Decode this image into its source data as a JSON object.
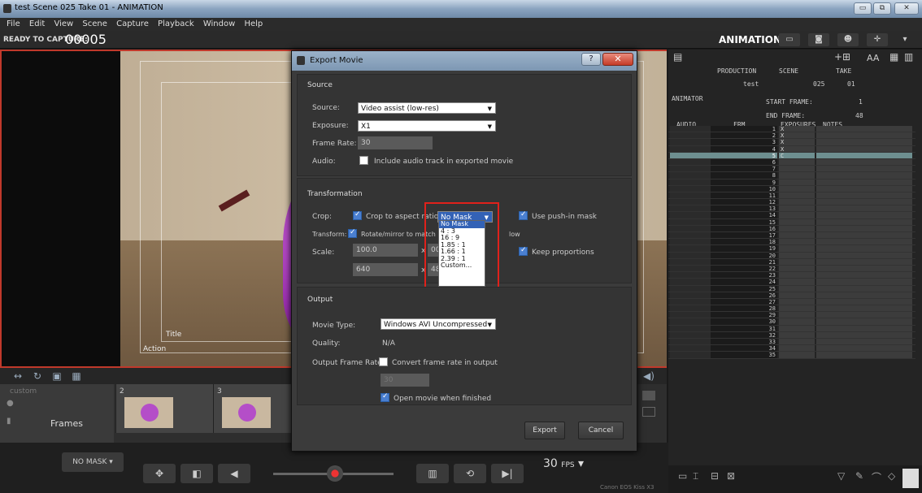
{
  "window": {
    "title": "test  Scene 025  Take 01 - ANIMATION",
    "minimize": "▭",
    "restore": "⧉",
    "close": "✕"
  },
  "menu": [
    "File",
    "Edit",
    "View",
    "Scene",
    "Capture",
    "Playback",
    "Window",
    "Help"
  ],
  "capture_bar": {
    "label": "READY TO CAPTURE:",
    "frame": "00005",
    "mode": "ANIMATION"
  },
  "viewer": {
    "title_guide": "Title",
    "action_guide": "Action"
  },
  "timeline": {
    "custom_label": "custom",
    "frames_label": "Frames",
    "thumbs": [
      {
        "n": "2"
      },
      {
        "n": "3"
      }
    ]
  },
  "bottom": {
    "mask_button": "NO MASK",
    "fps": "30",
    "fps_unit": "FPS",
    "camera": "Canon EOS Kiss X3"
  },
  "xsheet": {
    "hdr_production": "PRODUCTION",
    "hdr_scene": "SCENE",
    "hdr_take": "TAKE",
    "production": "test",
    "scene": "025",
    "take": "01",
    "animator_label": "ANIMATOR",
    "start_frame_label": "START FRAME:",
    "start_frame": "1",
    "end_frame_label": "END FRAME:",
    "end_frame": "48",
    "col_audio": "AUDIO",
    "col_frm": "FRM",
    "col_exposures": "EXPOSURES",
    "col_notes": "NOTES",
    "rows": [
      {
        "n": "1",
        "x": "X"
      },
      {
        "n": "2",
        "x": "X"
      },
      {
        "n": "3",
        "x": "X"
      },
      {
        "n": "4",
        "x": "X"
      },
      {
        "n": "5",
        "x": "C"
      },
      {
        "n": "6",
        "x": ""
      },
      {
        "n": "7",
        "x": ""
      },
      {
        "n": "8",
        "x": ""
      },
      {
        "n": "9",
        "x": ""
      },
      {
        "n": "10",
        "x": ""
      },
      {
        "n": "11",
        "x": ""
      },
      {
        "n": "12",
        "x": ""
      },
      {
        "n": "13",
        "x": ""
      },
      {
        "n": "14",
        "x": ""
      },
      {
        "n": "15",
        "x": ""
      },
      {
        "n": "16",
        "x": ""
      },
      {
        "n": "17",
        "x": ""
      },
      {
        "n": "18",
        "x": ""
      },
      {
        "n": "19",
        "x": ""
      },
      {
        "n": "20",
        "x": ""
      },
      {
        "n": "21",
        "x": ""
      },
      {
        "n": "22",
        "x": ""
      },
      {
        "n": "23",
        "x": ""
      },
      {
        "n": "24",
        "x": ""
      },
      {
        "n": "25",
        "x": ""
      },
      {
        "n": "26",
        "x": ""
      },
      {
        "n": "27",
        "x": ""
      },
      {
        "n": "28",
        "x": ""
      },
      {
        "n": "29",
        "x": ""
      },
      {
        "n": "30",
        "x": ""
      },
      {
        "n": "31",
        "x": ""
      },
      {
        "n": "32",
        "x": ""
      },
      {
        "n": "33",
        "x": ""
      },
      {
        "n": "34",
        "x": ""
      },
      {
        "n": "35",
        "x": ""
      }
    ]
  },
  "dialog": {
    "title": "Export Movie",
    "help": "?",
    "close": "✕",
    "source": {
      "section": "Source",
      "source_label": "Source:",
      "source_value": "Video assist (low-res)",
      "exposure_label": "Exposure:",
      "exposure_value": "X1",
      "frame_rate_label": "Frame Rate:",
      "frame_rate_value": "30",
      "audio_label": "Audio:",
      "audio_check": "Include audio track in exported movie"
    },
    "transformation": {
      "section": "Transformation",
      "crop_label": "Crop:",
      "crop_check": "Crop to aspect ratio",
      "mask_value": "No Mask",
      "push_in": "Use push-in mask",
      "transform_label": "Transform:",
      "transform_check": "Rotate/mirror to match",
      "transform_tail": "low",
      "scale_label": "Scale:",
      "scale_w": "100.0",
      "scale_x1": "x",
      "scale_h": "00",
      "size_w": "640",
      "scale_x2": "x",
      "size_h": "480",
      "keep_props": "Keep proportions",
      "dropdown": [
        "No Mask",
        "4 : 3",
        "16 : 9",
        "1.85 : 1",
        "1.66 : 1",
        "2.39 : 1",
        "Custom..."
      ]
    },
    "output": {
      "section": "Output",
      "movie_type_label": "Movie Type:",
      "movie_type": "Windows AVI Uncompressed",
      "quality_label": "Quality:",
      "quality": "N/A",
      "ofr_label": "Output Frame Rate",
      "ofr_check": "Convert frame rate in output",
      "ofr_value": "30",
      "open_check": "Open movie when finished"
    },
    "export_button": "Export",
    "cancel_button": "Cancel"
  }
}
